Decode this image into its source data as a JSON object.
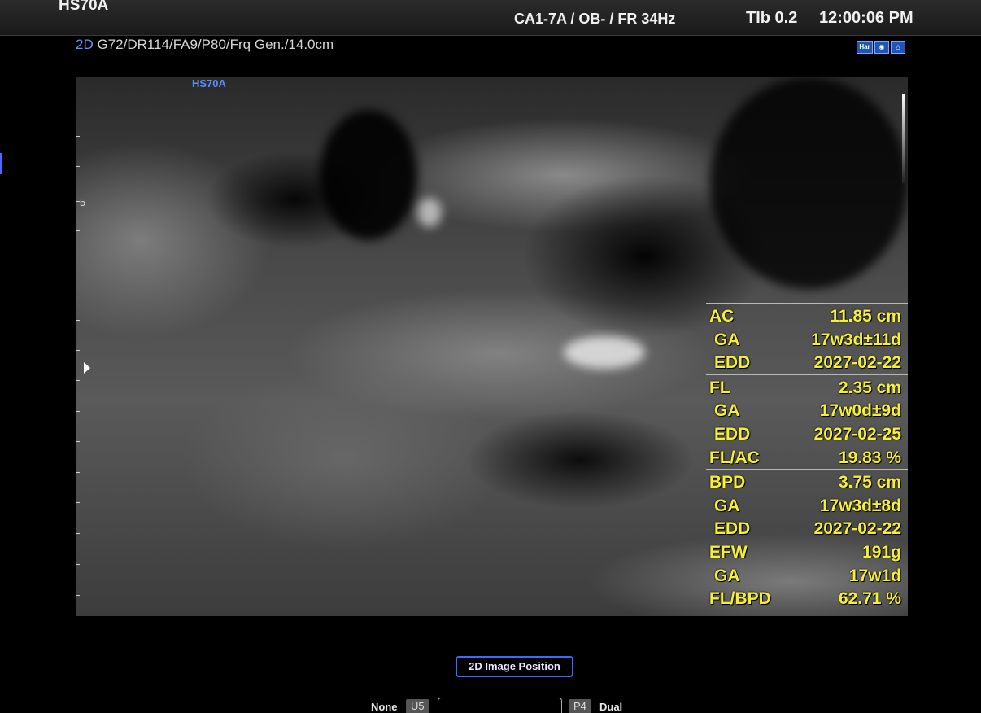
{
  "header": {
    "model": "HS70A",
    "probe_line": "CA1-7A / OB- / FR 34Hz",
    "tib": "TIb 0.2",
    "time": "12:00:06 PM"
  },
  "params": {
    "mode": "2D",
    "settings": " G72/DR114/FA9/P80/Frq Gen./14.0cm"
  },
  "status_icons": [
    "har-icon",
    "fetus-icon",
    "people-icon"
  ],
  "image": {
    "watermark": "HS70A",
    "depth_marker": "5"
  },
  "measurements": [
    {
      "rows": [
        {
          "label": "AC",
          "value": "11.85 cm",
          "sub": false
        },
        {
          "label": "GA",
          "value": "17w3d±11d",
          "sub": true
        },
        {
          "label": "EDD",
          "value": "2027-02-22",
          "sub": true
        }
      ]
    },
    {
      "rows": [
        {
          "label": "FL",
          "value": "2.35 cm",
          "sub": false
        },
        {
          "label": "GA",
          "value": "17w0d±9d",
          "sub": true
        },
        {
          "label": "EDD",
          "value": "2027-02-25",
          "sub": true
        },
        {
          "label": "FL/AC",
          "value": "19.83 %",
          "sub": false
        }
      ]
    },
    {
      "rows": [
        {
          "label": "BPD",
          "value": "3.75 cm",
          "sub": false
        },
        {
          "label": "GA",
          "value": "17w3d±8d",
          "sub": true
        },
        {
          "label": "EDD",
          "value": "2027-02-22",
          "sub": true
        },
        {
          "label": "EFW",
          "value": "191g",
          "sub": false
        },
        {
          "label": "GA",
          "value": "17w1d",
          "sub": true
        },
        {
          "label": "FL/BPD",
          "value": "62.71 %",
          "sub": false
        }
      ]
    }
  ],
  "controls": {
    "image_position_button": "2D Image Position",
    "left_label": "None",
    "left_badge": "U5",
    "right_badge": "P4",
    "right_label": "Dual"
  },
  "colors": {
    "measurement_text": "#f5ef3c",
    "accent_blue": "#3a6bff"
  }
}
